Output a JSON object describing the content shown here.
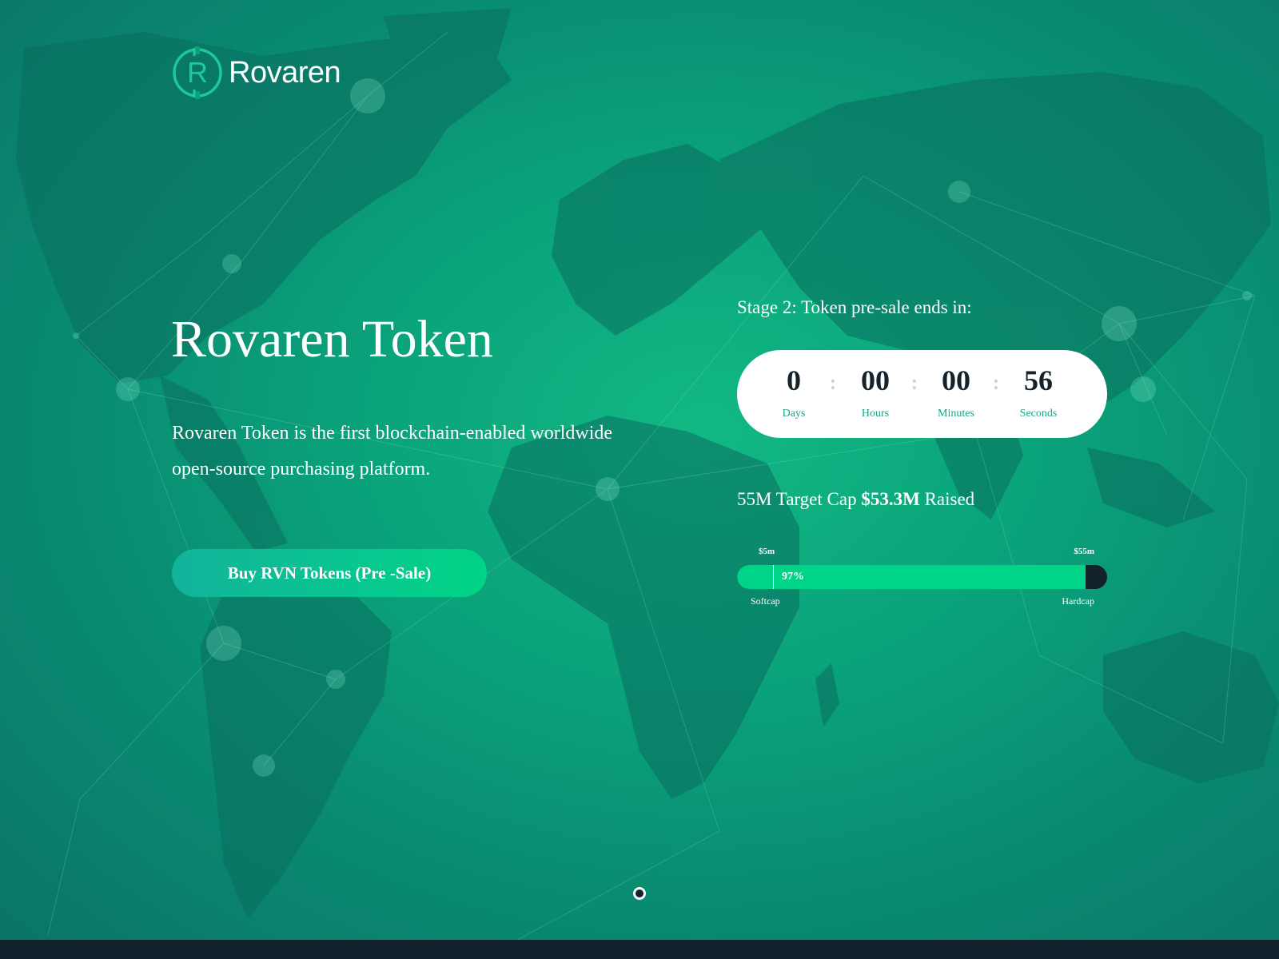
{
  "brand": {
    "name": "Rovaren",
    "logo_letter": "R",
    "accent": "#1fc79a"
  },
  "hero": {
    "title": "Rovaren Token",
    "description": "Rovaren Token is the first blockchain-enabled worldwide open-source purchasing platform.",
    "buy_button_label": "Buy RVN Tokens (Pre -Sale)"
  },
  "countdown": {
    "heading": "Stage 2: Token pre-sale ends in:",
    "units": [
      {
        "value": "0",
        "label": "Days"
      },
      {
        "value": "00",
        "label": "Hours"
      },
      {
        "value": "00",
        "label": "Minutes"
      },
      {
        "value": "56",
        "label": "Seconds"
      }
    ],
    "separator": ":"
  },
  "fundraise": {
    "target_text": "55M Target Cap",
    "raised_amount": "$53.3M",
    "raised_suffix": "Raised",
    "softcap_amount": "$5m",
    "hardcap_amount": "$55m",
    "softcap_label": "Softcap",
    "hardcap_label": "Hardcap",
    "progress_label": "97%",
    "progress_fraction": 0.97,
    "softcap_fraction": 0.097
  },
  "slider": {
    "active_index": 0,
    "count": 1
  },
  "colors": {
    "dark": "#14222c",
    "fill": "#00d488",
    "bg_mid": "#0aa27a"
  }
}
